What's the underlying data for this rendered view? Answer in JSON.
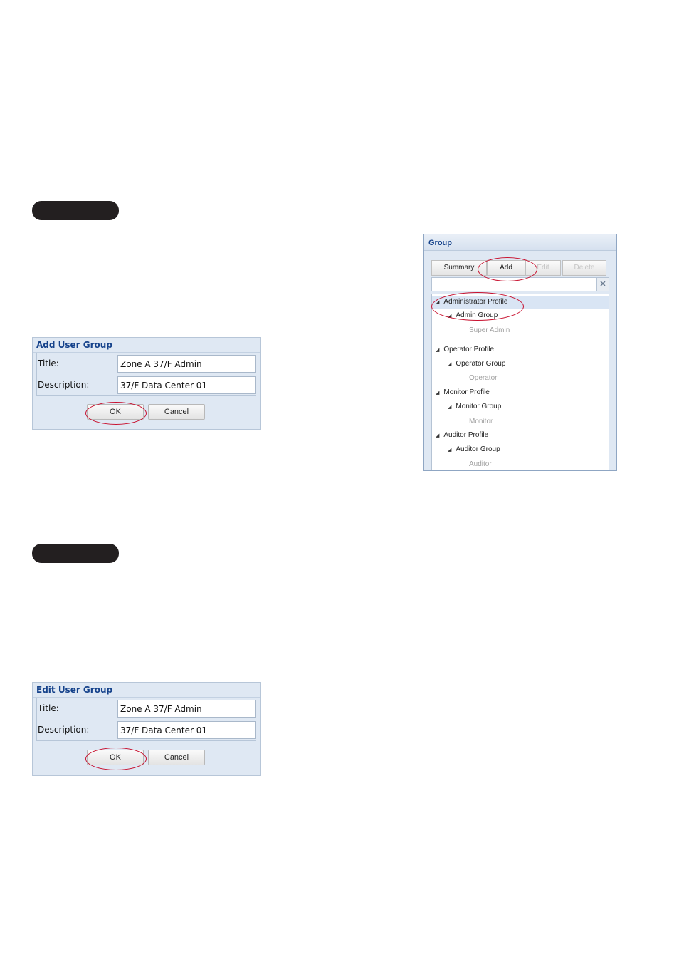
{
  "add_dialog": {
    "title": "Add User Group",
    "title_label": "Title:",
    "title_value": "Zone A 37/F Admin",
    "description_label": "Description:",
    "description_value": "37/F Data Center 01",
    "ok_label": "OK",
    "cancel_label": "Cancel"
  },
  "edit_dialog": {
    "title": "Edit User Group",
    "title_label": "Title:",
    "title_value": "Zone A 37/F Admin",
    "description_label": "Description:",
    "description_value": "37/F Data Center 01",
    "ok_label": "OK",
    "cancel_label": "Cancel"
  },
  "group_panel": {
    "title": "Group",
    "toolbar": {
      "summary_label": "Summary",
      "add_label": "Add",
      "edit_label": "Edit",
      "delete_label": "Delete"
    },
    "search": {
      "value": "",
      "clear_icon": "close-icon"
    },
    "tree": {
      "profiles": [
        {
          "label": "Administrator Profile",
          "group": "Admin Group",
          "member": "Super Admin"
        },
        {
          "label": "Operator Profile",
          "group": "Operator Group",
          "member": "Operator"
        },
        {
          "label": "Monitor Profile",
          "group": "Monitor Group",
          "member": "Monitor"
        },
        {
          "label": "Auditor Profile",
          "group": "Auditor Group",
          "member": "Auditor"
        }
      ]
    }
  },
  "colors": {
    "highlight_ellipse": "#c8102e",
    "dialog_title": "#15428b",
    "pill": "#231f20"
  }
}
